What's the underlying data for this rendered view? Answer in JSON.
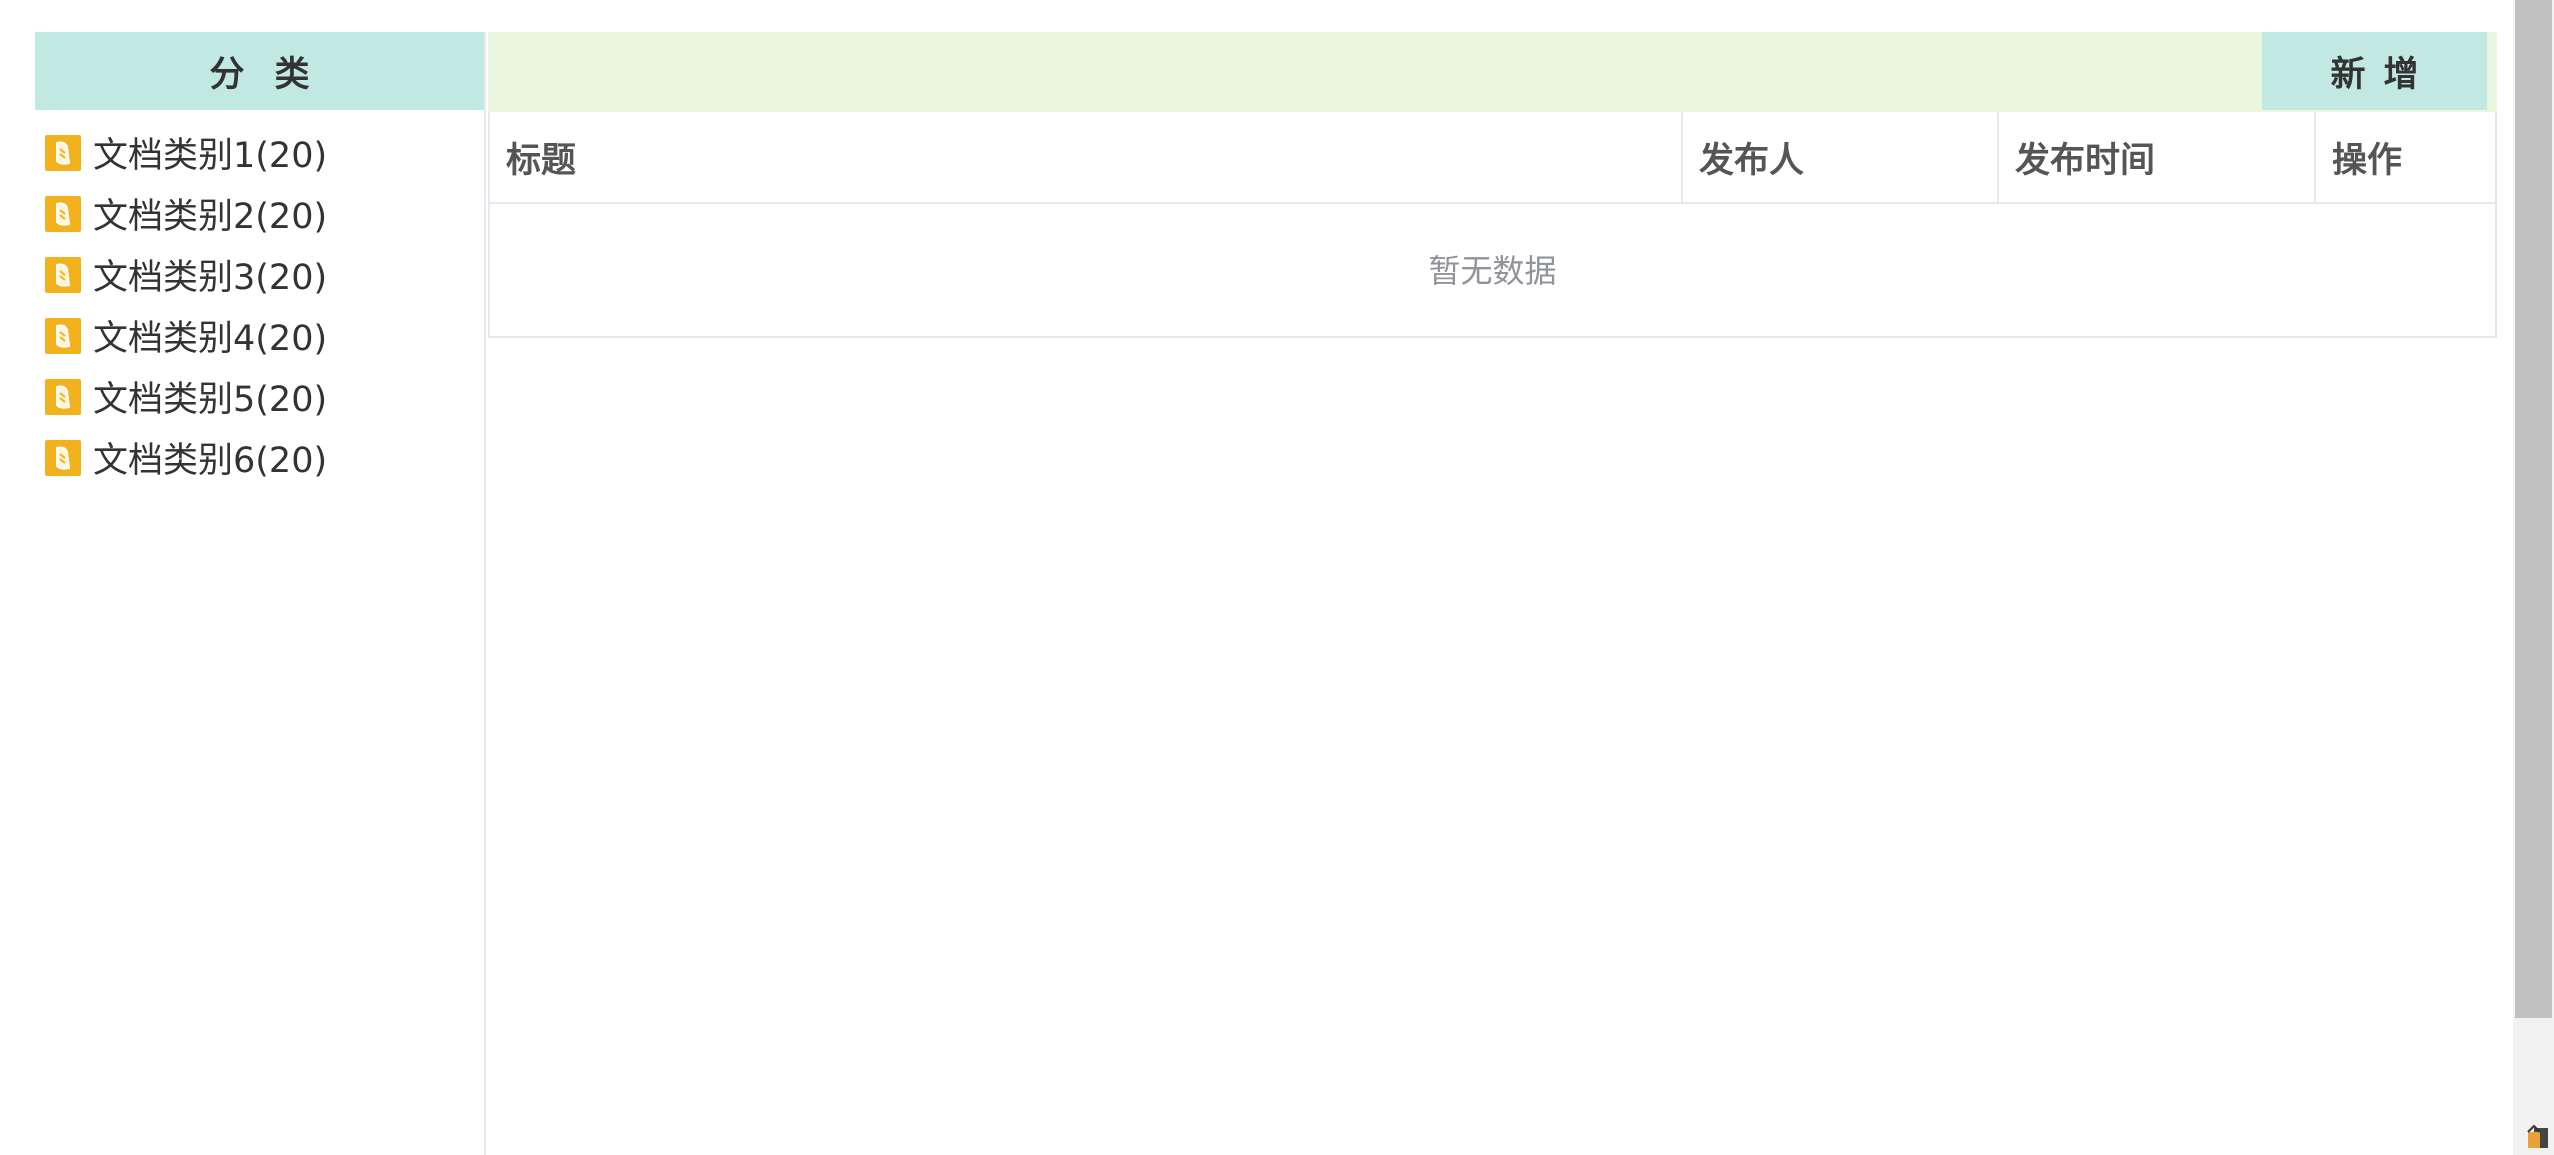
{
  "sidebar": {
    "header": "分类",
    "items": [
      {
        "label": "文档类别1(20)",
        "icon": "category-folder-icon"
      },
      {
        "label": "文档类别2(20)",
        "icon": "category-folder-icon"
      },
      {
        "label": "文档类别3(20)",
        "icon": "category-folder-icon"
      },
      {
        "label": "文档类别4(20)",
        "icon": "category-folder-icon"
      },
      {
        "label": "文档类别5(20)",
        "icon": "category-folder-icon"
      },
      {
        "label": "文档类别6(20)",
        "icon": "category-folder-icon"
      }
    ]
  },
  "toolbar": {
    "add_label": "新增"
  },
  "table": {
    "columns": [
      "标题",
      "发布人",
      "发布时间",
      "操作"
    ],
    "empty_text": "暂无数据"
  },
  "colors": {
    "header_bg": "#c1e9e2",
    "toolbar_bg": "#eaf6dd",
    "icon_bg": "#f2b21d",
    "border": "#e6e8ed"
  }
}
